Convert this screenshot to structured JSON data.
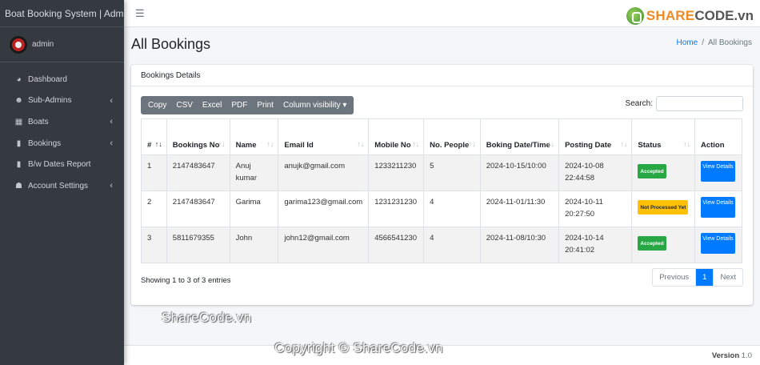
{
  "brand": "Boat Booking System | Admin",
  "user": {
    "name": "admin"
  },
  "sidebar": {
    "items": [
      {
        "label": "Dashboard",
        "icon": "tachometer-icon",
        "has_children": false
      },
      {
        "label": "Sub-Admins",
        "icon": "users-icon",
        "has_children": true
      },
      {
        "label": "Boats",
        "icon": "table-icon",
        "has_children": true
      },
      {
        "label": "Bookings",
        "icon": "file-icon",
        "has_children": true
      },
      {
        "label": "B/w Dates Report",
        "icon": "file-icon",
        "has_children": false
      },
      {
        "label": "Account Settings",
        "icon": "user-cog-icon",
        "has_children": true
      }
    ]
  },
  "header": {
    "logo_part1": "SHARE",
    "logo_part2": "CODE.vn"
  },
  "page": {
    "title": "All Bookings",
    "breadcrumb_home": "Home",
    "breadcrumb_sep": "/",
    "breadcrumb_current": "All Bookings"
  },
  "card": {
    "title": "Bookings Details",
    "buttons": [
      "Copy",
      "CSV",
      "Excel",
      "PDF",
      "Print",
      "Column visibility ▾"
    ],
    "search_label": "Search:",
    "search_value": ""
  },
  "table": {
    "headers": [
      "#",
      "Bookings No",
      "Name",
      "Email Id",
      "Mobile No",
      "No. People",
      "Boking Date/Time",
      "Posting Date",
      "Status",
      "Action"
    ],
    "rows": [
      {
        "n": "1",
        "booking_no": "2147483647",
        "name": "Anuj kumar",
        "email": "anujk@gmail.com",
        "mobile": "1233211230",
        "people": "5",
        "boking": "2024-10-15/10:00",
        "posting": "2024-10-08 22:44:58",
        "status": "Accepted",
        "action": "View Details"
      },
      {
        "n": "2",
        "booking_no": "2147483647",
        "name": "Garima",
        "email": "garima123@gmail.com",
        "mobile": "1231231230",
        "people": "4",
        "boking": "2024-11-01/11:30",
        "posting": "2024-10-11 20:27:50",
        "status": "Not Processed Yet",
        "action": "View Details"
      },
      {
        "n": "3",
        "booking_no": "5811679355",
        "name": "John",
        "email": "john12@gmail.com",
        "mobile": "4566541230",
        "people": "4",
        "boking": "2024-11-08/10:30",
        "posting": "2024-10-14 20:41:02",
        "status": "Accepted",
        "action": "View Details"
      }
    ]
  },
  "pagination": {
    "info": "Showing 1 to 3 of 3 entries",
    "previous": "Previous",
    "current": "1",
    "next": "Next"
  },
  "footer": {
    "version_label": "Version",
    "version": "1.0"
  },
  "watermarks": [
    "ShareCode.vn",
    "Copyright © ShareCode.vn"
  ],
  "colors": {
    "sidebar": "#343a40",
    "primary": "#007bff",
    "success": "#28a745",
    "warning": "#ffc107",
    "button_group": "#6c757d"
  }
}
